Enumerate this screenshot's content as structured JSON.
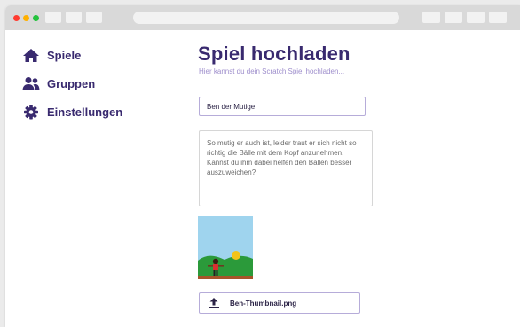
{
  "nav": {
    "items": [
      {
        "label": "Spiele",
        "icon": "home-icon"
      },
      {
        "label": "Gruppen",
        "icon": "users-icon"
      },
      {
        "label": "Einstellungen",
        "icon": "gear-icon"
      }
    ]
  },
  "main": {
    "title": "Spiel hochladen",
    "subtitle": "Hier kannst du dein Scratch Spiel hochladen...",
    "name_value": "Ben der Mutige",
    "description_value": "So mutig er auch ist, leider traut er sich nicht so richtig die Bälle mit dem Kopf anzunehmen. Kannst du ihm dabei helfen den Bällen besser auszuweichen?",
    "thumbnail_icon": "game-thumbnail-image",
    "file_icon": "upload-icon",
    "file_name": "Ben-Thumbnail.png"
  },
  "colors": {
    "accent": "#392a6f",
    "subtitle": "#9e8ecc",
    "input_border": "#b6acd9"
  }
}
